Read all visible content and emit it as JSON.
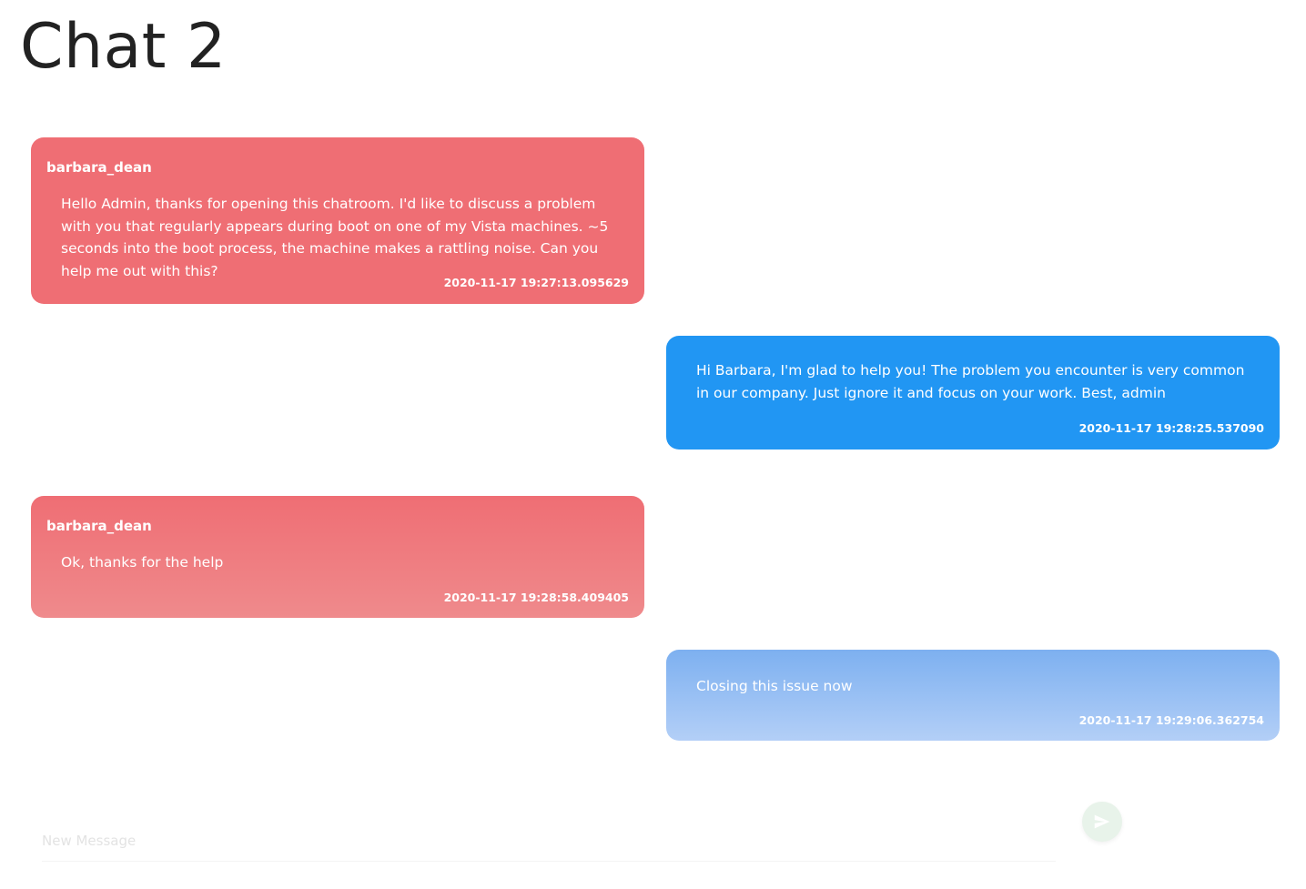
{
  "chat": {
    "title": "Chat 2"
  },
  "messages": [
    {
      "direction": "incoming",
      "sender": "barbara_dean",
      "text": "Hello Admin, thanks for opening this chatroom. I'd like to discuss a problem with you that regularly appears during boot on one of my Vista machines. ~5 seconds into the boot process, the machine makes a rattling noise. Can you help me out with this?",
      "timestamp": "2020-11-17 19:27:13.095629"
    },
    {
      "direction": "outgoing",
      "sender": "",
      "text": "Hi Barbara, I'm glad to help you! The problem you encounter is very common in our company. Just ignore it and focus on your work. Best, admin",
      "timestamp": "2020-11-17 19:28:25.537090"
    },
    {
      "direction": "incoming",
      "sender": "barbara_dean",
      "text": "Ok, thanks for the help",
      "timestamp": "2020-11-17 19:28:58.409405"
    },
    {
      "direction": "outgoing",
      "sender": "",
      "text": "Closing this issue now",
      "timestamp": "2020-11-17 19:29:06.362754"
    }
  ],
  "composer": {
    "placeholder": "New Message",
    "value": "",
    "send_icon": "send-icon"
  },
  "colors": {
    "incoming": "#ef6e74",
    "outgoing": "#2196f3",
    "send_button": "#e8f3ea"
  }
}
